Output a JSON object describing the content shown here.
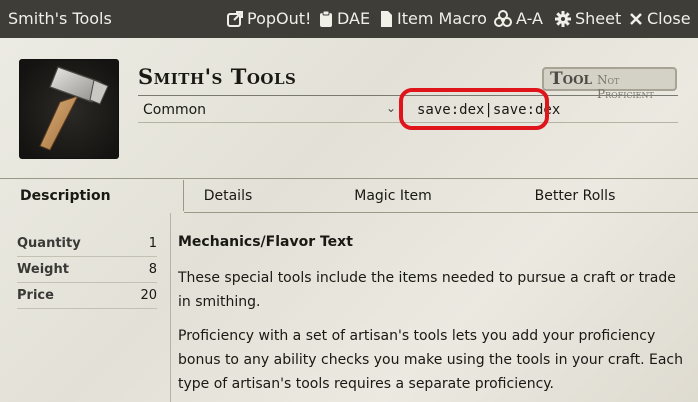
{
  "window": {
    "title": "Smith's Tools",
    "buttons": [
      {
        "label": "PopOut!",
        "icon": "external-link-icon"
      },
      {
        "label": "DAE",
        "icon": "clipboard-icon"
      },
      {
        "label": "Item Macro",
        "icon": "file-icon"
      },
      {
        "label": "A-A",
        "icon": "biohazard-icon"
      },
      {
        "label": "Sheet",
        "icon": "gear-icon"
      },
      {
        "label": "Close",
        "icon": "close-icon"
      }
    ]
  },
  "item": {
    "name": "Smith's Tools",
    "type": "Tool",
    "proficiency": "Not Proficient",
    "rarity": "Common",
    "save_field": "save:dex|save:dex",
    "image_icon": "hammer-icon"
  },
  "tabs": [
    "Description",
    "Details",
    "Magic Item",
    "Better Rolls"
  ],
  "properties": [
    {
      "label": "Quantity",
      "value": "1"
    },
    {
      "label": "Weight",
      "value": "8"
    },
    {
      "label": "Price",
      "value": "20"
    }
  ],
  "description": {
    "heading": "Mechanics/Flavor Text",
    "p1": "These special tools include the items needed to pursue a craft or trade in smithing.",
    "p2": "Proficiency with a set of artisan's tools lets you add your proficiency bonus to any ability checks you make using the tools in your craft. Each type of artisan's tools requires a separate proficiency."
  },
  "colors": {
    "header": "#3e3d38",
    "highlight": "#e0141b",
    "background": "#e6e2d8"
  }
}
